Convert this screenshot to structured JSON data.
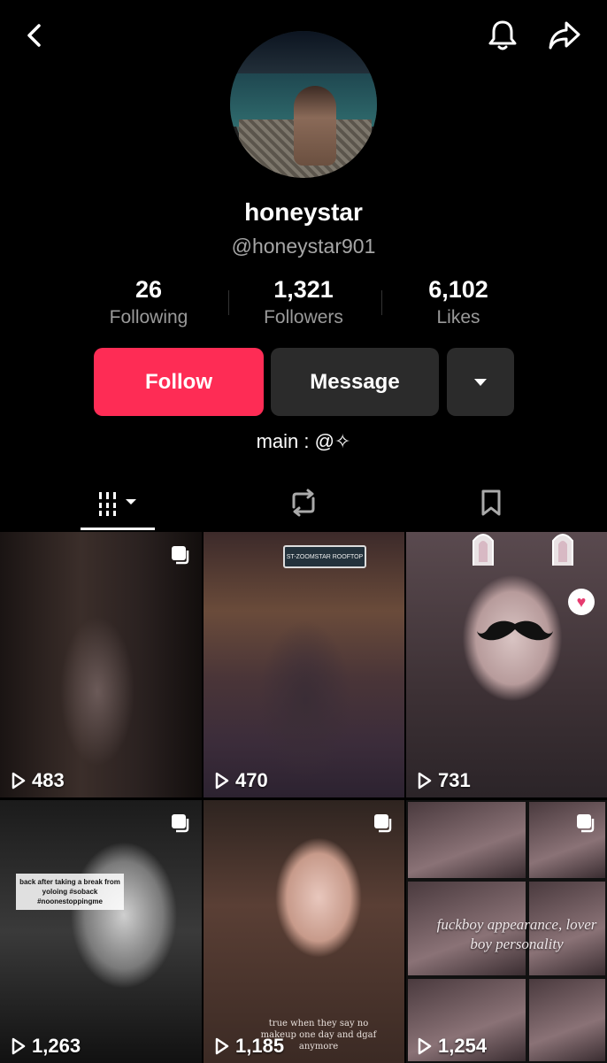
{
  "header": {
    "back_icon": "chevron-left-icon",
    "notification_icon": "bell-icon",
    "share_icon": "share-arrow-icon"
  },
  "profile": {
    "display_name": "honeystar",
    "username": "@honeystar901",
    "bio": "main : @✧"
  },
  "stats": {
    "following": {
      "value": "26",
      "label": "Following"
    },
    "followers": {
      "value": "1,321",
      "label": "Followers"
    },
    "likes": {
      "value": "6,102",
      "label": "Likes"
    }
  },
  "actions": {
    "follow_label": "Follow",
    "message_label": "Message",
    "more_icon": "caret-down-icon",
    "follow_color": "#fe2c55"
  },
  "tabs": [
    {
      "name": "videos",
      "icon": "grid-icon",
      "selected": true
    },
    {
      "name": "reposts",
      "icon": "repost-icon",
      "selected": false
    },
    {
      "name": "saved",
      "icon": "bookmark-icon",
      "selected": false
    }
  ],
  "videos": [
    {
      "views": "483",
      "multi": true
    },
    {
      "views": "470",
      "multi": false,
      "sign_text": "ST-ZOOMSTAR ROOFTOP"
    },
    {
      "views": "731",
      "multi": false
    },
    {
      "views": "1,263",
      "multi": true,
      "caption": "back after taking a break from yoloing #soback #noonestoppingme"
    },
    {
      "views": "1,185",
      "multi": true,
      "caption": "true when they say no makeup one day and dgaf anymore"
    },
    {
      "views": "1,254",
      "multi": true,
      "caption": "fuckboy appearance, lover boy personality"
    }
  ]
}
